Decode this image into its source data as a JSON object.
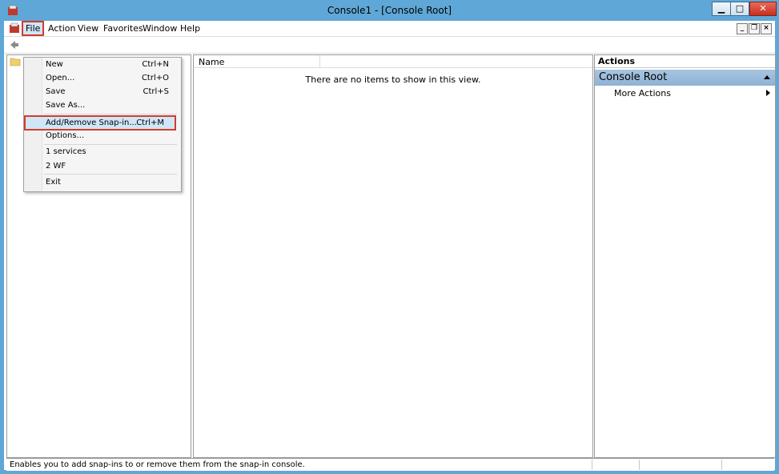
{
  "window": {
    "title": "Console1 - [Console Root]"
  },
  "menubar": {
    "items": [
      "File",
      "Action",
      "View",
      "Favorites",
      "Window",
      "Help"
    ]
  },
  "file_menu": {
    "items": [
      {
        "label": "New",
        "shortcut": "Ctrl+N"
      },
      {
        "label": "Open...",
        "shortcut": "Ctrl+O"
      },
      {
        "label": "Save",
        "shortcut": "Ctrl+S"
      },
      {
        "label": "Save As...",
        "shortcut": ""
      },
      {
        "label": "Add/Remove Snap-in...",
        "shortcut": "Ctrl+M"
      },
      {
        "label": "Options...",
        "shortcut": ""
      },
      {
        "label": "1 services",
        "shortcut": ""
      },
      {
        "label": "2 WF",
        "shortcut": ""
      },
      {
        "label": "Exit",
        "shortcut": ""
      }
    ]
  },
  "center": {
    "column_name": "Name",
    "empty_message": "There are no items to show in this view."
  },
  "actions": {
    "header": "Actions",
    "group": "Console Root",
    "more": "More Actions"
  },
  "status": {
    "text": "Enables you to add snap-ins to or remove them from the snap-in console."
  },
  "colors": {
    "accent": "#d43b2b",
    "highlight": "#cfe6f7",
    "titlebar": "#5fa7d6"
  }
}
